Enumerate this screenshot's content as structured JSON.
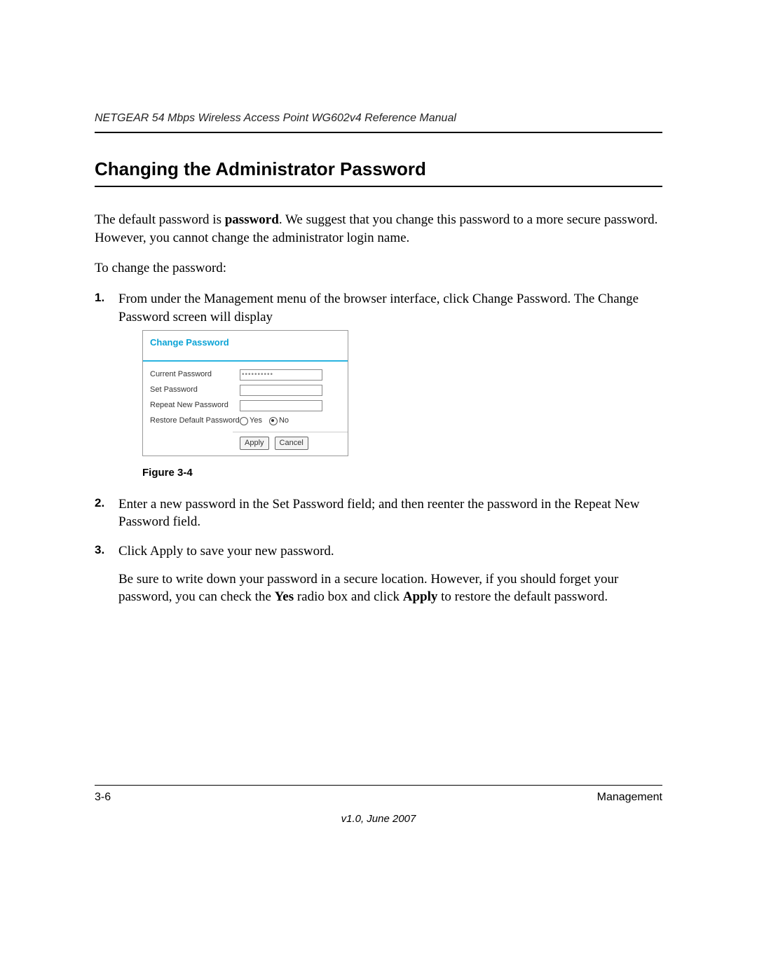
{
  "header": {
    "title": "NETGEAR 54 Mbps Wireless Access Point WG602v4 Reference Manual"
  },
  "section": {
    "title": "Changing the Administrator Password",
    "intro_a": "The default password is ",
    "intro_bold": "password",
    "intro_b": ". We suggest that you change this password to a more secure password. However, you cannot change the administrator login name.",
    "lead": "To change the password:"
  },
  "steps": {
    "s1_num": "1.",
    "s1_a": "From under the ",
    "s1_b1": "Management",
    "s1_c": " menu of the browser interface, click ",
    "s1_b2": "Change Password.",
    "s1_d": " The ",
    "s1_b3": "Change Password",
    "s1_e": " screen will display",
    "s2_num": "2.",
    "s2_a": "Enter a new password in the ",
    "s2_b1": "Set Password",
    "s2_c": " field; and then reenter the password in the ",
    "s2_b2": "Repeat New Password",
    "s2_d": " field.",
    "s3_num": "3.",
    "s3_a": "Click ",
    "s3_b1": "Apply",
    "s3_c": " to save your new password.",
    "note_a": "Be sure to write down your password in a secure location. However, if you should forget your password, you can check the ",
    "note_b1": "Yes",
    "note_b": " radio box and click ",
    "note_b2": "Apply",
    "note_c": " to restore the default password."
  },
  "figure": {
    "panel_title": "Change Password",
    "labels": {
      "current": "Current Password",
      "set": "Set Password",
      "repeat": "Repeat New Password",
      "restore": "Restore Default Password"
    },
    "current_value": "••••••••••",
    "radio_yes": "Yes",
    "radio_no": "No",
    "radio_selected": "No",
    "btn_apply": "Apply",
    "btn_cancel": "Cancel",
    "caption": "Figure 3-4"
  },
  "footer": {
    "page": "3-6",
    "section": "Management",
    "version": "v1.0, June 2007"
  }
}
